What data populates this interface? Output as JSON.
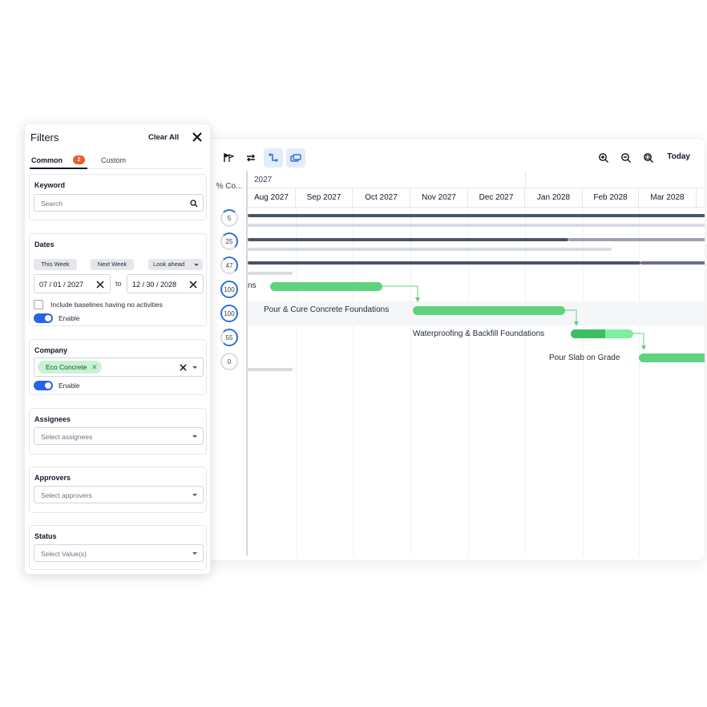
{
  "toolbar": {
    "icons": [
      "flags-icon",
      "swap-icon",
      "dependency-link-icon",
      "layers-icon"
    ],
    "zoom_icons": [
      "zoom-in-icon",
      "zoom-out-icon",
      "zoom-fit-icon"
    ],
    "today_label": "Today"
  },
  "gantt": {
    "pct_header": "% Co...",
    "year": "2027",
    "months": [
      "Aug 2027",
      "Sep 2027",
      "Oct 2027",
      "Nov 2027",
      "Dec 2027",
      "Jan 2028",
      "Feb 2028",
      "Mar 2028"
    ],
    "rows": [
      {
        "pct": "5",
        "label": ""
      },
      {
        "pct": "25",
        "label": ""
      },
      {
        "pct": "47",
        "label": ""
      },
      {
        "pct": "100",
        "label": "ns"
      },
      {
        "pct": "100",
        "label": "Pour & Cure Concrete Foundations"
      },
      {
        "pct": "55",
        "label": "Waterproofing & Backfill Foundations"
      },
      {
        "pct": "0",
        "label": "Pour Slab on Grade"
      }
    ],
    "colors": {
      "task": "#5fd27f",
      "task_dark": "#3cbf63",
      "summary": "#4b5563",
      "summary_light": "#d8dbe0",
      "accent": "#2f6fe0"
    }
  },
  "filters": {
    "title": "Filters",
    "clear_all": "Clear All",
    "tabs": [
      {
        "label": "Common",
        "badge": "2"
      },
      {
        "label": "Custom"
      }
    ],
    "keyword": {
      "label": "Keyword",
      "placeholder": "Search"
    },
    "dates": {
      "label": "Dates",
      "presets": [
        "This Week",
        "Next Week",
        "Look ahead"
      ],
      "from": "07 / 01 / 2027",
      "to_label": "to",
      "to": "12 / 30 / 2028",
      "include_baselines": "Include baselines having no activities",
      "enable": "Enable"
    },
    "company": {
      "label": "Company",
      "tag": "Eco Concrete",
      "enable": "Enable"
    },
    "assignees": {
      "label": "Assignees",
      "placeholder": "Select assignees"
    },
    "approvers": {
      "label": "Approvers",
      "placeholder": "Select approvers"
    },
    "status": {
      "label": "Status",
      "placeholder": "Select Value(s)"
    }
  }
}
